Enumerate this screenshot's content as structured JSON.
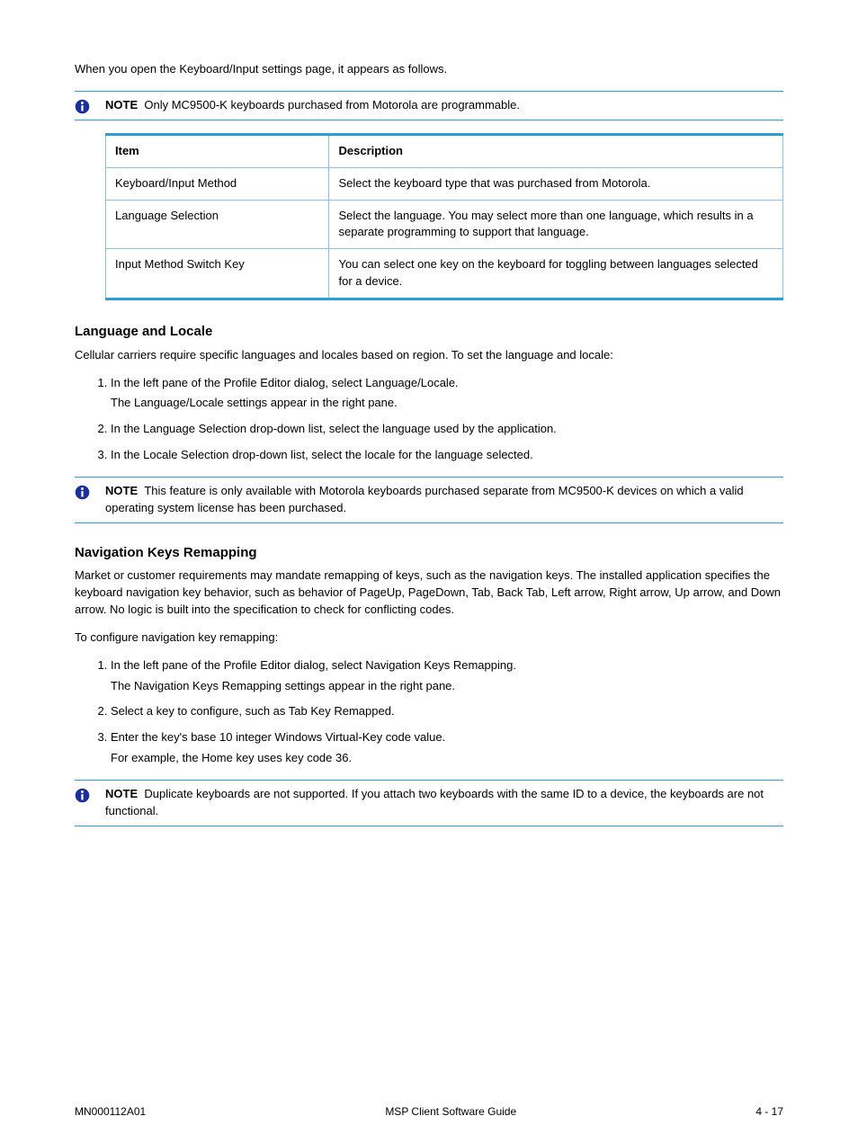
{
  "intro": "When you open the Keyboard/Input settings page, it appears as follows.",
  "notes": [
    "Only MC9500-K keyboards purchased from Motorola are programmable.",
    "This feature is only available with Motorola keyboards purchased separate from MC9500-K devices on which a valid operating system license has been purchased.",
    "Duplicate keyboards are not supported. If you attach two keyboards with the same ID to a device, the keyboards are not functional."
  ],
  "table": {
    "headers": [
      "Item",
      "Description"
    ],
    "rows": [
      [
        "Keyboard/Input Method",
        "Select the keyboard type that was purchased from Motorola."
      ],
      [
        "Language Selection",
        "Select the language. You may select more than one language, which results in a separate programming to support that language."
      ],
      [
        "Input Method Switch Key",
        "You can select one key on the keyboard for toggling between languages selected for a device."
      ]
    ]
  },
  "section_locale": {
    "title": "Language and Locale",
    "p1": "Cellular carriers require specific languages and locales based on region. To set the language and locale:",
    "steps": [
      {
        "t": "In the left pane of the Profile Editor dialog, select Language/Locale.",
        "d": "The Language/Locale settings appear in the right pane."
      },
      {
        "t": "In the Language Selection drop-down list, select the language used by the application."
      },
      {
        "t": "In the Locale Selection drop-down list, select the locale for the language selected."
      }
    ]
  },
  "section_nav": {
    "title": "Navigation Keys Remapping",
    "p1": "Market or customer requirements may mandate remapping of keys, such as the navigation keys. The installed application specifies the keyboard navigation key behavior, such as behavior of PageUp, PageDown, Tab, Back Tab, Left arrow, Right arrow, Up arrow, and Down arrow. No logic is built into the specification to check for conflicting codes.",
    "p2": "To configure navigation key remapping:",
    "steps": [
      {
        "t": "In the left pane of the Profile Editor dialog, select Navigation Keys Remapping.",
        "d": "The Navigation Keys Remapping settings appear in the right pane."
      },
      {
        "t": "Select a key to configure, such as Tab Key Remapped."
      },
      {
        "t": "Enter the key's base 10 integer Windows Virtual-Key code value.",
        "d": "For example, the Home key uses key code 36."
      }
    ]
  },
  "footer": {
    "left": "MN000112A01",
    "center": "MSP Client Software Guide",
    "right": "4 - 17"
  }
}
